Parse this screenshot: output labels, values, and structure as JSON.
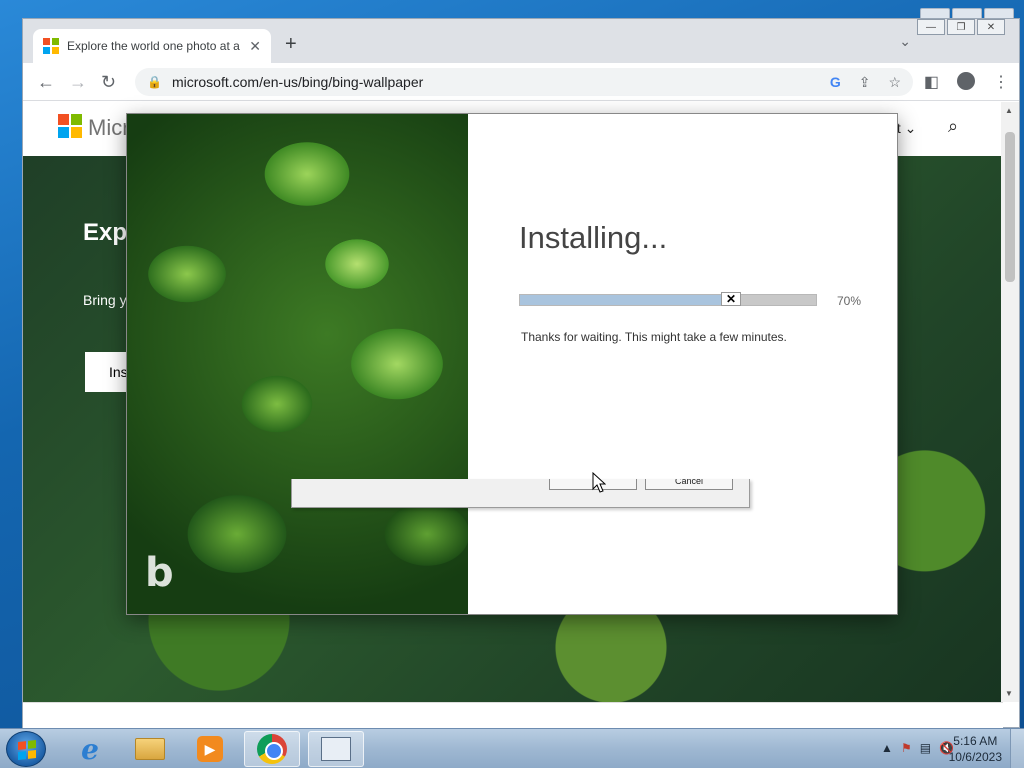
{
  "browser": {
    "tab_title": "Explore the world one photo at a",
    "tab_close": "✕",
    "new_tab": "+",
    "tab_menu": "⌄",
    "url": "microsoft.com/en-us/bing/bing-wallpaper",
    "back": "←",
    "forward": "→",
    "reload": "↻"
  },
  "page": {
    "brand": "Micro",
    "header_right": "ft ⌄",
    "hero_title": "Expl a tin",
    "hero_sub": "Bring y each d",
    "hero_button": "Ins"
  },
  "installer": {
    "title": "Installing...",
    "progress_percent": 70,
    "progress_label": "70%",
    "progress_close": "✕",
    "message": "Thanks for waiting. This might take a few minutes.",
    "logo_letter": "b"
  },
  "ghost_dialog": {
    "cancel_label": "Cancel"
  },
  "taskbar": {
    "time": "5:16 AM",
    "date": "10/6/2023"
  },
  "colors": {
    "ms_red": "#f25022",
    "ms_green": "#7fba00",
    "ms_blue": "#00a4ef",
    "ms_yellow": "#ffb900",
    "progress_fill": "#a9c4de"
  }
}
